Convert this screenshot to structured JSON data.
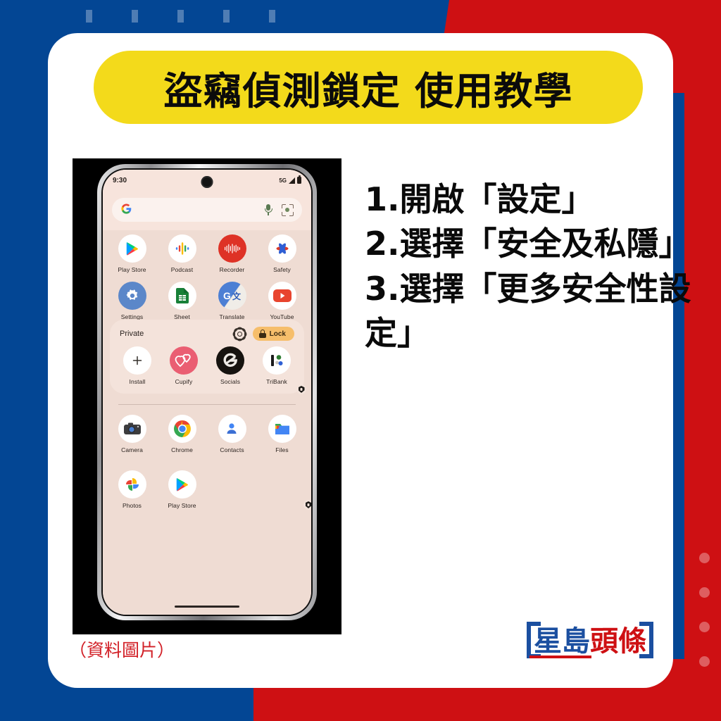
{
  "theme": {
    "blue": "#034694",
    "red": "#CE1013",
    "yellow": "#F3DA1B",
    "card": "#FFFFFF",
    "caption_red": "#D22027",
    "lock_pill": "#F6BE6B"
  },
  "header": {
    "title": "盜竊偵測鎖定  使用教學"
  },
  "steps": [
    "1.開啟「設定」",
    "2.選擇「安全及私隱」",
    "3.選擇「更多安全性設定」"
  ],
  "caption": "（資料圖片）",
  "logo": {
    "text_blue": "星島",
    "text_red": "頭條",
    "name": "星島頭條"
  },
  "phone": {
    "status": {
      "time": "9:30",
      "network": "5G",
      "signal_icon": "signal-bars-icon",
      "battery_icon": "battery-icon"
    },
    "search": {
      "google_icon": "google-g-icon",
      "mic_icon": "microphone-icon",
      "lens_icon": "google-lens-icon",
      "placeholder": ""
    },
    "top_apps": [
      {
        "label": "Play Store",
        "icon": "play-store-icon"
      },
      {
        "label": "Podcast",
        "icon": "google-podcast-icon"
      },
      {
        "label": "Recorder",
        "icon": "recorder-icon"
      },
      {
        "label": "Safety",
        "icon": "personal-safety-icon"
      },
      {
        "label": "Settings",
        "icon": "settings-gear-icon"
      },
      {
        "label": "Sheet",
        "icon": "google-sheets-icon"
      },
      {
        "label": "Translate",
        "icon": "google-translate-icon"
      },
      {
        "label": "YouTube",
        "icon": "youtube-icon"
      }
    ],
    "private": {
      "title": "Private",
      "settings_icon": "gear-icon",
      "lock_label": "Lock",
      "lock_icon": "padlock-icon",
      "apps": [
        {
          "label": "Install",
          "icon": "plus-install-icon",
          "locked": false
        },
        {
          "label": "Cupify",
          "icon": "cupify-hearts-icon",
          "locked": true
        },
        {
          "label": "Socials",
          "icon": "socials-icon",
          "locked": true
        },
        {
          "label": "TriBank",
          "icon": "tribank-icon",
          "locked": true
        }
      ]
    },
    "bottom_apps": [
      {
        "label": "Camera",
        "icon": "camera-icon",
        "locked": true
      },
      {
        "label": "Chrome",
        "icon": "chrome-icon",
        "locked": true
      },
      {
        "label": "Contacts",
        "icon": "contacts-icon",
        "locked": true
      },
      {
        "label": "Files",
        "icon": "files-icon",
        "locked": true
      },
      {
        "label": "Photos",
        "icon": "google-photos-icon",
        "locked": true
      },
      {
        "label": "Play Store",
        "icon": "play-store-icon",
        "locked": true
      }
    ]
  }
}
